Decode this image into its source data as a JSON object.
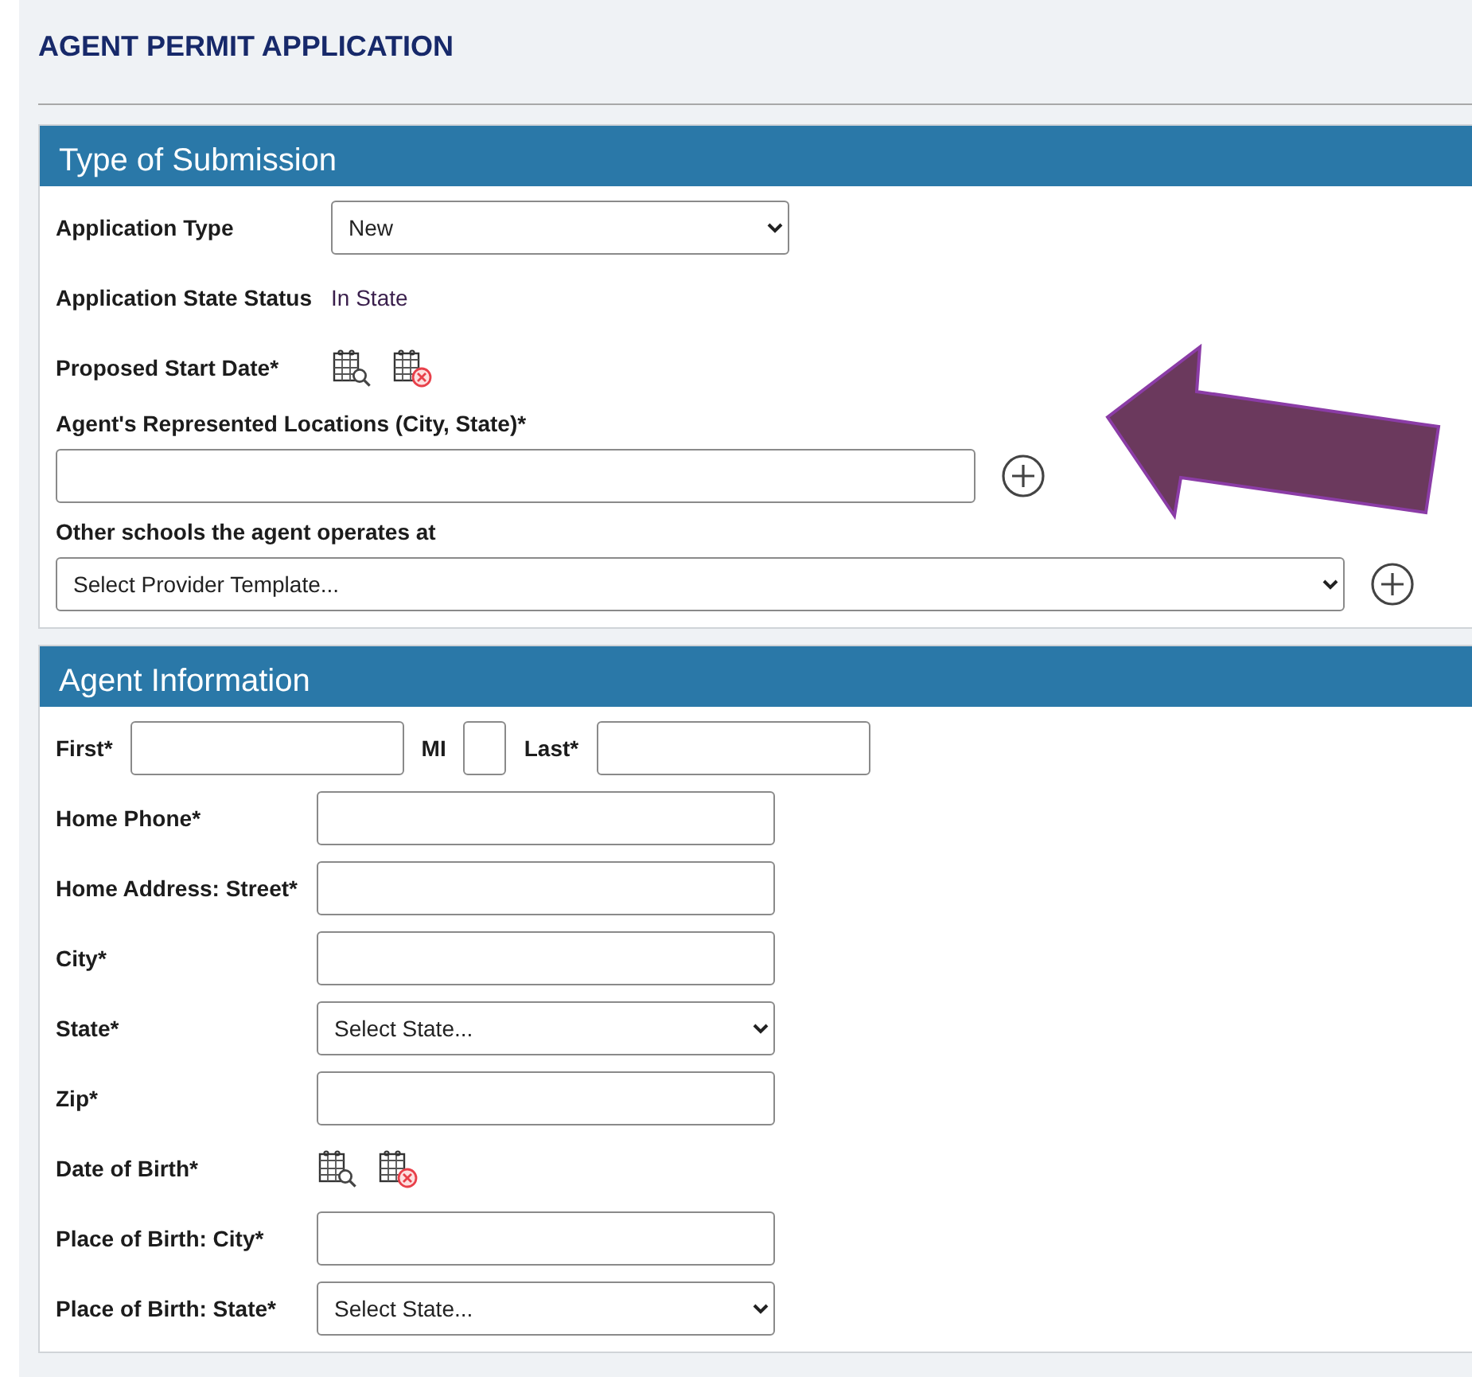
{
  "page": {
    "title": "AGENT PERMIT APPLICATION"
  },
  "sections": [
    {
      "title": "Type of Submission",
      "rows": [
        {
          "kind": "select",
          "label": "Application Type",
          "value": "New"
        },
        {
          "kind": "static",
          "label": "Application State Status",
          "value": "In State"
        },
        {
          "kind": "date",
          "label": "Proposed Start Date*"
        },
        {
          "kind": "stacked_input",
          "label": "Agent's Represented Locations (City, State)*"
        },
        {
          "kind": "stacked_select",
          "label": "Other schools the agent operates at",
          "value": "Select Provider Template..."
        }
      ]
    },
    {
      "title": "Agent Information",
      "rows": [
        {
          "kind": "name",
          "fields": [
            {
              "label": "First*"
            },
            {
              "label": "MI"
            },
            {
              "label": "Last*"
            }
          ]
        },
        {
          "kind": "input",
          "label": "Home Phone*"
        },
        {
          "kind": "input",
          "label": "Home Address: Street*"
        },
        {
          "kind": "input",
          "label": "City*"
        },
        {
          "kind": "select",
          "label": "State*",
          "value": "Select State..."
        },
        {
          "kind": "input",
          "label": "Zip*"
        },
        {
          "kind": "date",
          "label": "Date of Birth*"
        },
        {
          "kind": "input",
          "label": "Place of Birth: City*"
        },
        {
          "kind": "select",
          "label": "Place of Birth: State*",
          "value": "Select State..."
        }
      ]
    }
  ]
}
